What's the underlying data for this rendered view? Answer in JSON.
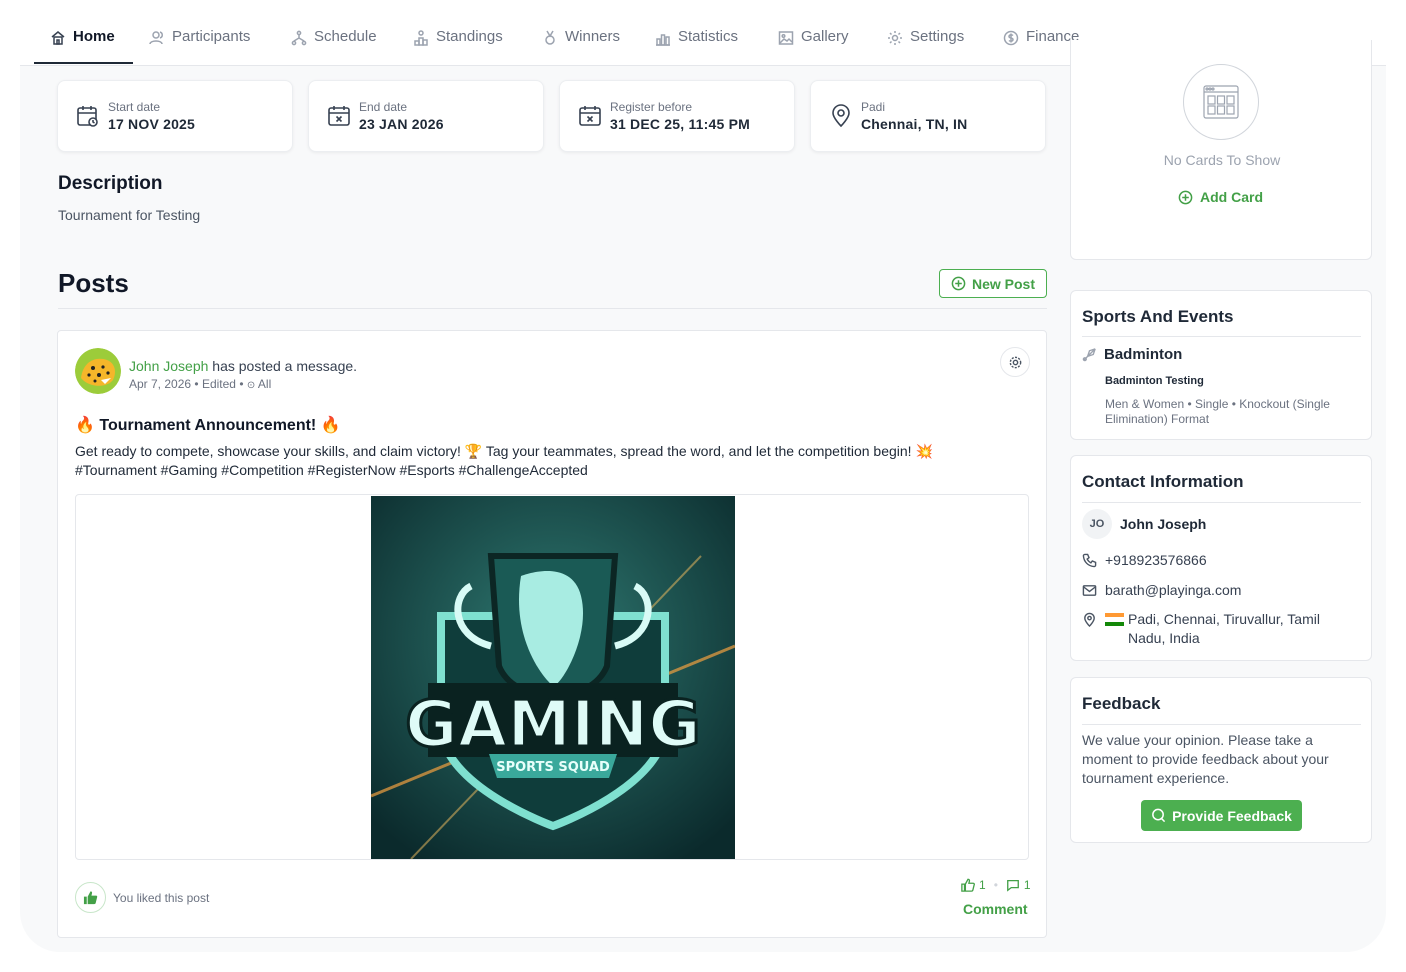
{
  "nav": {
    "tabs": [
      {
        "label": "Home",
        "icon": "home-icon",
        "active": true
      },
      {
        "label": "Participants",
        "icon": "users-icon"
      },
      {
        "label": "Schedule",
        "icon": "bracket-icon"
      },
      {
        "label": "Standings",
        "icon": "podium-icon"
      },
      {
        "label": "Winners",
        "icon": "medal-icon"
      },
      {
        "label": "Statistics",
        "icon": "chart-icon"
      },
      {
        "label": "Gallery",
        "icon": "image-icon"
      },
      {
        "label": "Settings",
        "icon": "gear-icon"
      },
      {
        "label": "Finance",
        "icon": "dollar-icon"
      }
    ]
  },
  "info": {
    "start": {
      "label": "Start date",
      "value": "17 NOV 2025"
    },
    "end": {
      "label": "End date",
      "value": "23 JAN 2026"
    },
    "register": {
      "label": "Register before",
      "value": "31 DEC 25, 11:45 PM"
    },
    "location": {
      "label": "Padi",
      "value": "Chennai, TN, IN"
    }
  },
  "description": {
    "heading": "Description",
    "text": "Tournament for Testing"
  },
  "posts": {
    "heading": "Posts",
    "new_post_label": "New Post",
    "post": {
      "author": "John Joseph",
      "action": " has posted a message.",
      "date": "Apr 7, 2026",
      "edited": "Edited",
      "visibility": "All",
      "title": "🔥 Tournament Announcement! 🔥",
      "body": "Get ready to compete, showcase your skills, and claim victory! 🏆 Tag your teammates, spread the word, and let the competition begin! 💥 #Tournament #Gaming #Competition #RegisterNow #Esports #ChallengeAccepted",
      "image_text": "GAMING",
      "image_subtext": "SPORTS SQUAD",
      "liked_text": "You liked this post",
      "likes": "1",
      "comments": "1",
      "comment_label": "Comment"
    }
  },
  "cards": {
    "empty_text": "No Cards To Show",
    "add_label": "Add Card"
  },
  "sports": {
    "heading": "Sports And Events",
    "sport": "Badminton",
    "event": "Badminton Testing",
    "meta": "Men & Women • Single • Knockout (Single Elimination) Format"
  },
  "contact": {
    "heading": "Contact Information",
    "initials": "JO",
    "name": "John Joseph",
    "phone": "+918923576866",
    "email": "barath@playinga.com",
    "address": "Padi, Chennai, Tiruvallur, Tamil Nadu, India"
  },
  "feedback": {
    "heading": "Feedback",
    "text": "We value your opinion. Please take a moment to provide feedback about your tournament experience.",
    "button_label": "Provide Feedback"
  },
  "colors": {
    "accent": "#43a047",
    "button_green": "#4caf50"
  }
}
